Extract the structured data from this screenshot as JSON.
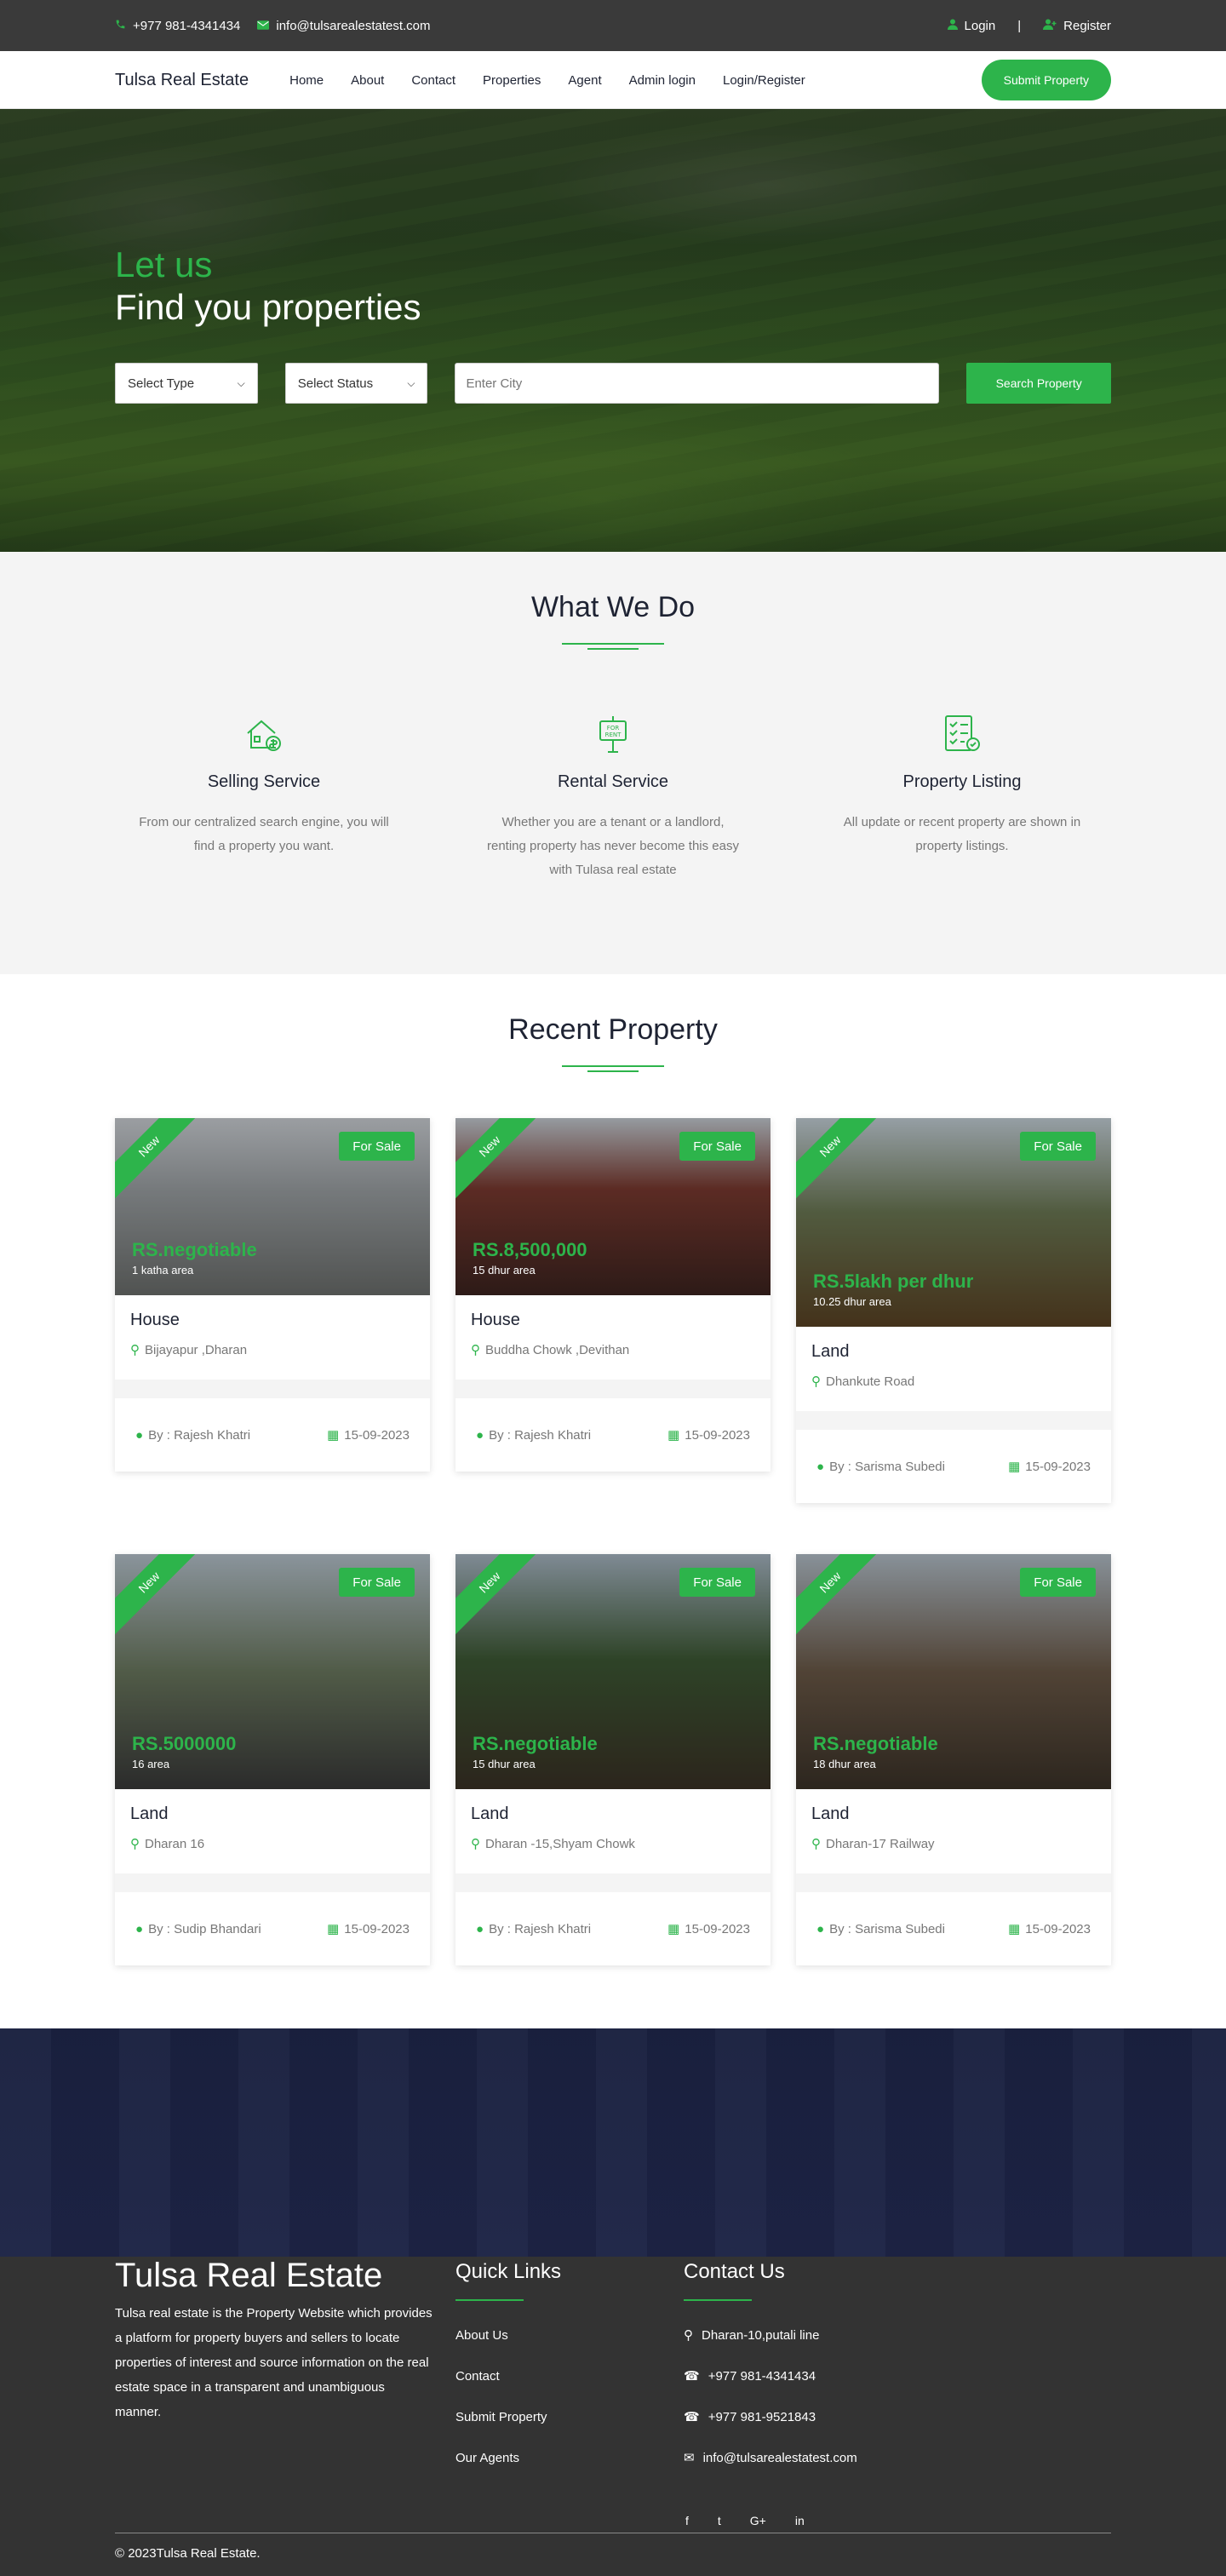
{
  "topbar": {
    "phone": "+977 981-4341434",
    "email": "info@tulsarealestatest.com",
    "login": "Login",
    "separator": "|",
    "register": "Register"
  },
  "nav": {
    "brand": "Tulsa Real Estate",
    "links": [
      "Home",
      "About",
      "Contact",
      "Properties",
      "Agent",
      "Admin login",
      "Login/Register"
    ],
    "submit": "Submit Property"
  },
  "hero": {
    "line1": "Let us",
    "line2": "Find you properties",
    "select_type": "Select Type",
    "select_status": "Select Status",
    "city_placeholder": "Enter City",
    "search_button": "Search Property"
  },
  "what": {
    "title": "What We Do",
    "services": [
      {
        "title": "Selling Service",
        "text": "From our centralized search engine, you will find a property you want.",
        "icon": "house-sale-icon"
      },
      {
        "title": "Rental Service",
        "text": "Whether you are a tenant or a landlord, renting property has never become this easy with Tulasa real estate",
        "icon": "for-rent-sign-icon"
      },
      {
        "title": "Property Listing",
        "text": "All update or recent property are shown in property listings.",
        "icon": "checklist-icon"
      }
    ]
  },
  "recent": {
    "title": "Recent Property",
    "ribbon": "New",
    "badge": "For Sale",
    "by_prefix": "By : ",
    "cards": [
      {
        "price": "RS.negotiable",
        "area": "1 katha area",
        "type": "House",
        "location": "Bijayapur ,Dharan",
        "agent": "Rajesh Khatri",
        "date": "15-09-2023"
      },
      {
        "price": "RS.8,500,000",
        "area": "15 dhur area",
        "type": "House",
        "location": "Buddha Chowk ,Devithan",
        "agent": "Rajesh Khatri",
        "date": "15-09-2023"
      },
      {
        "price": "RS.5lakh per dhur",
        "area": "10.25 dhur area",
        "type": "Land",
        "location": "Dhankute Road",
        "agent": "Sarisma Subedi",
        "date": "15-09-2023"
      },
      {
        "price": "RS.5000000",
        "area": "16 area",
        "type": "Land",
        "location": "Dharan 16",
        "agent": "Sudip Bhandari",
        "date": "15-09-2023"
      },
      {
        "price": "RS.negotiable",
        "area": "15 dhur area",
        "type": "Land",
        "location": "Dharan -15,Shyam Chowk",
        "agent": "Rajesh Khatri",
        "date": "15-09-2023"
      },
      {
        "price": "RS.negotiable",
        "area": "18 dhur area",
        "type": "Land",
        "location": "Dharan-17 Railway",
        "agent": "Sarisma Subedi",
        "date": "15-09-2023"
      }
    ]
  },
  "footer": {
    "brand": "Tulsa Real Estate",
    "about": "Tulsa real estate is the Property Website which provides a platform for property buyers and sellers to locate properties of interest and source information on the real estate space in a transparent and unambiguous manner.",
    "quick_title": "Quick Links",
    "quick_links": [
      "About Us",
      "Contact",
      "Submit Property",
      "Our Agents"
    ],
    "contact_title": "Contact Us",
    "address": "Dharan-10,putali line",
    "phone1": "+977 981-4341434",
    "phone2": "+977 981-9521843",
    "email": "info@tulsarealestatest.com",
    "social": [
      "f",
      "t",
      "G+",
      "in"
    ],
    "copyright": "© 2023Tulsa Real Estate."
  }
}
